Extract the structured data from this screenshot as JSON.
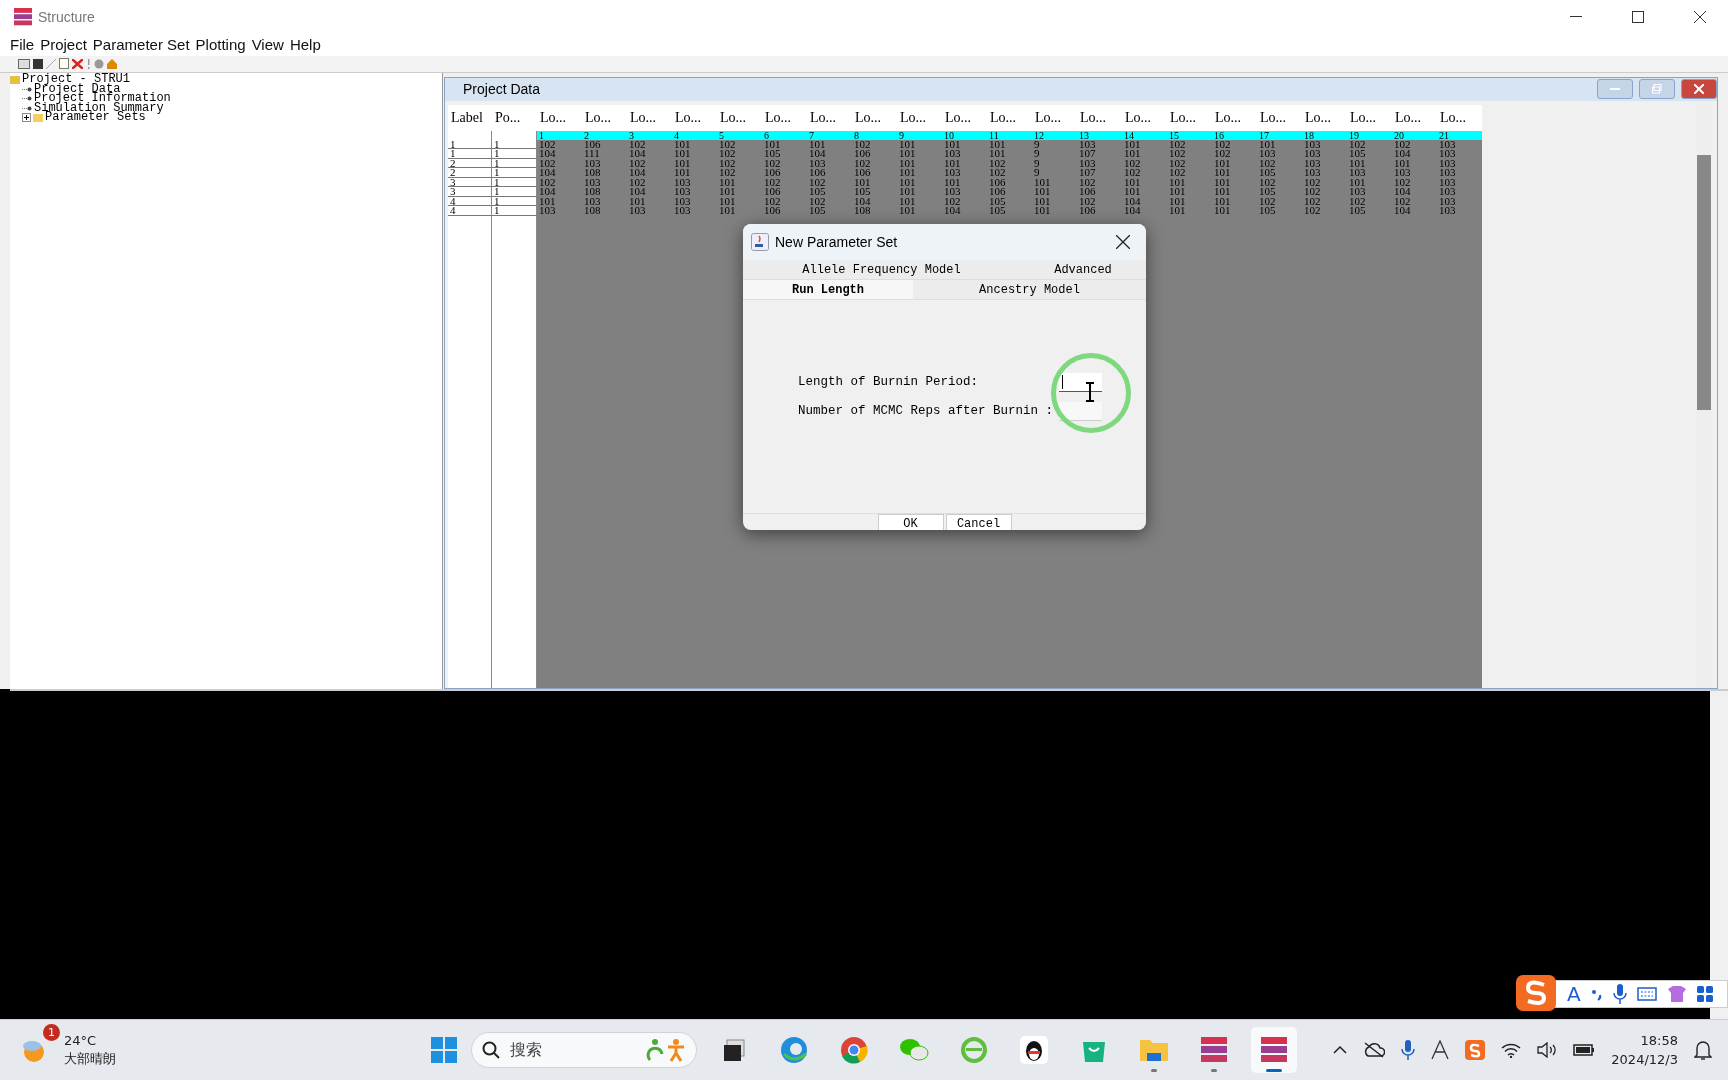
{
  "window": {
    "title": "Structure"
  },
  "menu": [
    "File",
    "Project",
    "Parameter Set",
    "Plotting",
    "View",
    "Help"
  ],
  "tree": [
    {
      "label": "Project - STRU1",
      "expanded": true,
      "children": [
        {
          "label": "Project Data"
        },
        {
          "label": "Project Information"
        },
        {
          "label": "Simulation Summary"
        },
        {
          "label": "Parameter Sets",
          "expanded": false
        }
      ]
    }
  ],
  "project_data": {
    "title": "Project Data",
    "columns": [
      "Label",
      "Po...",
      "Lo...",
      "Lo...",
      "Lo...",
      "Lo...",
      "Lo...",
      "Lo...",
      "Lo...",
      "Lo...",
      "Lo...",
      "Lo...",
      "Lo...",
      "Lo...",
      "Lo...",
      "Lo...",
      "Lo...",
      "Lo...",
      "Lo...",
      "Lo...",
      "Lo...",
      "Lo...",
      "Lo..."
    ],
    "locus_numbers": [
      "1",
      "2",
      "3",
      "4",
      "5",
      "6",
      "7",
      "8",
      "9",
      "10",
      "11",
      "12",
      "13",
      "14",
      "15",
      "16",
      "17",
      "18",
      "19",
      "20",
      "21"
    ],
    "rows": [
      {
        "label": "1",
        "pop": "1",
        "loci": [
          "102",
          "106",
          "102",
          "101",
          "102",
          "101",
          "101",
          "102",
          "101",
          "101",
          "101",
          "9",
          "103",
          "101",
          "102",
          "102",
          "101",
          "103",
          "102",
          "102",
          "103"
        ]
      },
      {
        "label": "1",
        "pop": "1",
        "loci": [
          "104",
          "111",
          "104",
          "101",
          "102",
          "105",
          "104",
          "106",
          "101",
          "103",
          "101",
          "9",
          "107",
          "101",
          "102",
          "102",
          "103",
          "103",
          "105",
          "104",
          "103"
        ]
      },
      {
        "label": "2",
        "pop": "1",
        "loci": [
          "102",
          "103",
          "102",
          "101",
          "102",
          "102",
          "103",
          "102",
          "101",
          "101",
          "102",
          "9",
          "103",
          "102",
          "102",
          "101",
          "102",
          "103",
          "101",
          "101",
          "103"
        ]
      },
      {
        "label": "2",
        "pop": "1",
        "loci": [
          "104",
          "108",
          "104",
          "101",
          "102",
          "106",
          "106",
          "106",
          "101",
          "103",
          "102",
          "9",
          "107",
          "102",
          "102",
          "101",
          "105",
          "103",
          "103",
          "103",
          "103"
        ]
      },
      {
        "label": "3",
        "pop": "1",
        "loci": [
          "102",
          "103",
          "102",
          "103",
          "101",
          "102",
          "102",
          "101",
          "101",
          "101",
          "106",
          "101",
          "102",
          "101",
          "101",
          "101",
          "102",
          "102",
          "101",
          "102",
          "103"
        ]
      },
      {
        "label": "3",
        "pop": "1",
        "loci": [
          "104",
          "108",
          "104",
          "103",
          "101",
          "106",
          "105",
          "105",
          "101",
          "103",
          "106",
          "101",
          "106",
          "101",
          "101",
          "101",
          "105",
          "102",
          "103",
          "104",
          "103"
        ]
      },
      {
        "label": "4",
        "pop": "1",
        "loci": [
          "101",
          "103",
          "101",
          "103",
          "101",
          "102",
          "102",
          "104",
          "101",
          "102",
          "105",
          "101",
          "102",
          "104",
          "101",
          "101",
          "102",
          "102",
          "102",
          "102",
          "103"
        ]
      },
      {
        "label": "4",
        "pop": "1",
        "loci": [
          "103",
          "108",
          "103",
          "103",
          "101",
          "106",
          "105",
          "108",
          "101",
          "104",
          "105",
          "101",
          "106",
          "104",
          "101",
          "101",
          "105",
          "102",
          "105",
          "104",
          "103"
        ]
      }
    ]
  },
  "dialog": {
    "title": "New Parameter Set",
    "tab_rows": [
      [
        {
          "label": "Allele Frequency Model",
          "selected": false
        },
        {
          "label": "Advanced",
          "selected": false
        }
      ],
      [
        {
          "label": "Run Length",
          "selected": true
        },
        {
          "label": "Ancestry Model",
          "selected": false
        }
      ]
    ],
    "fields": [
      {
        "label": "Length of Burnin Period:",
        "focused": true
      },
      {
        "label": "Number of MCMC Reps after Burnin :",
        "focused": false
      }
    ],
    "buttons": [
      "OK",
      "Cancel"
    ]
  },
  "ime_bar": {
    "mode": "A"
  },
  "taskbar": {
    "weather": {
      "temperature": "24°C",
      "condition": "大部晴朗",
      "badge": "1"
    },
    "search": {
      "placeholder": "搜索"
    },
    "apps": [
      {
        "kind": "taskview",
        "running": false,
        "selected": false
      },
      {
        "kind": "edge",
        "running": false,
        "selected": false
      },
      {
        "kind": "chrome",
        "running": false,
        "selected": false
      },
      {
        "kind": "wechat",
        "running": false,
        "selected": false
      },
      {
        "kind": "ie",
        "running": false,
        "selected": false
      },
      {
        "kind": "qq",
        "running": false,
        "selected": false
      },
      {
        "kind": "shop",
        "running": false,
        "selected": false
      },
      {
        "kind": "folder",
        "running": true,
        "selected": false
      },
      {
        "kind": "structure",
        "running": true,
        "selected": false
      },
      {
        "kind": "structure",
        "running": true,
        "selected": true
      }
    ],
    "time": "18:58",
    "date": "2024/12/3"
  }
}
